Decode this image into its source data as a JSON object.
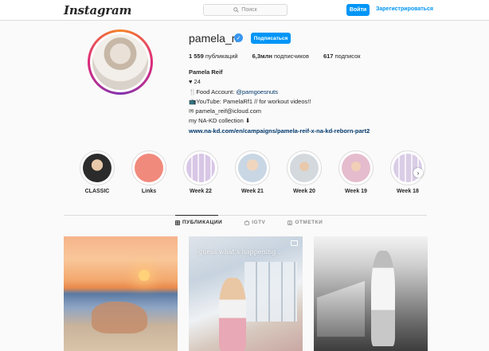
{
  "header": {
    "logo": "Instagram",
    "search_placeholder": "Поиск",
    "login_label": "Войти",
    "register_label": "Зарегистрироваться"
  },
  "profile": {
    "username": "pamela_rf",
    "verified": true,
    "follow_label": "Подписаться",
    "stats": {
      "posts_value": "1 559",
      "posts_label": "публикаций",
      "followers_value": "6,3млн",
      "followers_label": "подписчиков",
      "following_value": "617",
      "following_label": "подписок"
    },
    "bio": {
      "name": "Pamela Reif",
      "line_heart": "♥ 24",
      "food_prefix": "🍴Food Account: ",
      "food_tag": "@pamgoesnuts",
      "youtube": "📺YouTube: PamelaRf1 // for workout videos!!",
      "email": "✉ pamela_reif@icloud.com",
      "collection": "my NA-KD collection ⬇",
      "link": "www.na-kd.com/en/campaigns/pamela-reif-x-na-kd-reborn-part2"
    }
  },
  "highlights": [
    {
      "label": "CLASSIC",
      "color": "#2b2b2b"
    },
    {
      "label": "Links",
      "color": "#f08a7c"
    },
    {
      "label": "Week 22",
      "color": "#d8c6e6"
    },
    {
      "label": "Week 21",
      "color": "#c9d6e4"
    },
    {
      "label": "Week 20",
      "color": "#d4d9de"
    },
    {
      "label": "Week 19",
      "color": "#e5bccd"
    },
    {
      "label": "Week 18",
      "color": "#d9cde6"
    }
  ],
  "tabs": [
    {
      "label": "ПУБЛИКАЦИИ",
      "icon": "grid-icon",
      "active": true
    },
    {
      "label": "IGTV",
      "icon": "igtv-icon",
      "active": false
    },
    {
      "label": "ОТМЕТКИ",
      "icon": "tagged-icon",
      "active": false
    }
  ],
  "posts": [
    {
      "caption": ""
    },
    {
      "caption": "guess what's happening .."
    },
    {
      "caption": ""
    }
  ],
  "colors": {
    "accent": "#0095f6",
    "link": "#00376b",
    "border": "#dbdbdb"
  }
}
